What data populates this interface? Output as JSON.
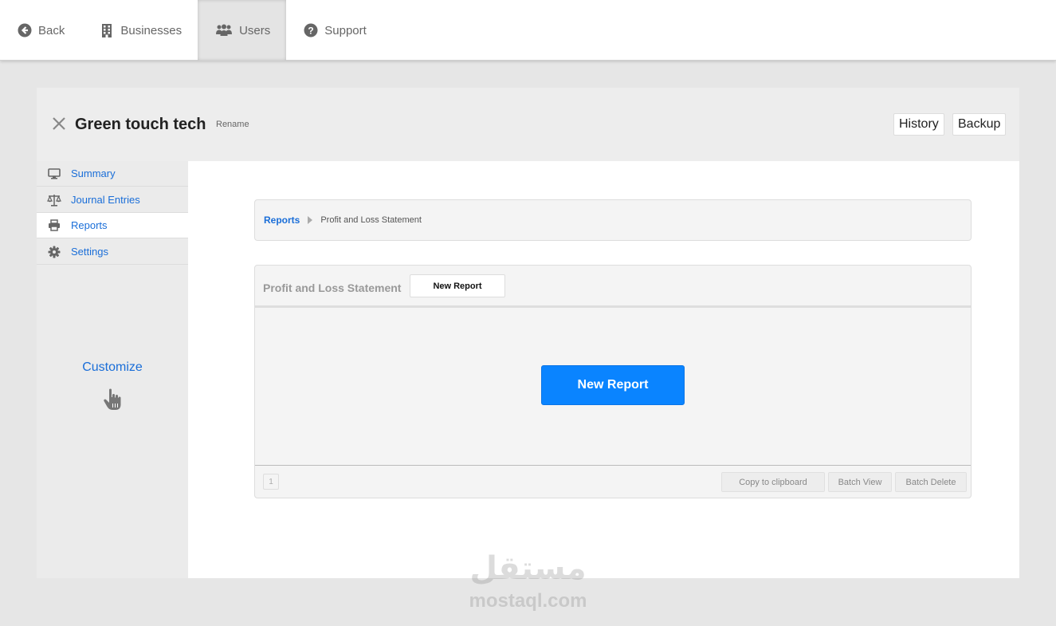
{
  "nav": {
    "back": "Back",
    "businesses": "Businesses",
    "users": "Users",
    "support": "Support",
    "active": "users"
  },
  "business": {
    "title": "Green touch tech",
    "rename": "Rename",
    "history": "History",
    "backup": "Backup"
  },
  "sidebar": {
    "items": [
      {
        "label": "Summary",
        "icon": "monitor-icon"
      },
      {
        "label": "Journal Entries",
        "icon": "balance-scale-icon"
      },
      {
        "label": "Reports",
        "icon": "printer-icon"
      },
      {
        "label": "Settings",
        "icon": "gear-icon"
      }
    ],
    "active": "Reports",
    "customize": "Customize"
  },
  "breadcrumb": {
    "root": "Reports",
    "current": "Profit and Loss Statement"
  },
  "report_panel": {
    "title": "Profit and Loss Statement",
    "new_report_small": "New Report",
    "new_report_big": "New Report",
    "page_number": "1",
    "copy_clipboard": "Copy to clipboard",
    "batch_view": "Batch View",
    "batch_delete": "Batch Delete"
  },
  "watermark": {
    "arabic": "مستقل",
    "latin": "mostaql.com"
  },
  "colors": {
    "accent": "#0a84ff",
    "link": "#1a6ed8",
    "background": "#e6e6e6"
  }
}
